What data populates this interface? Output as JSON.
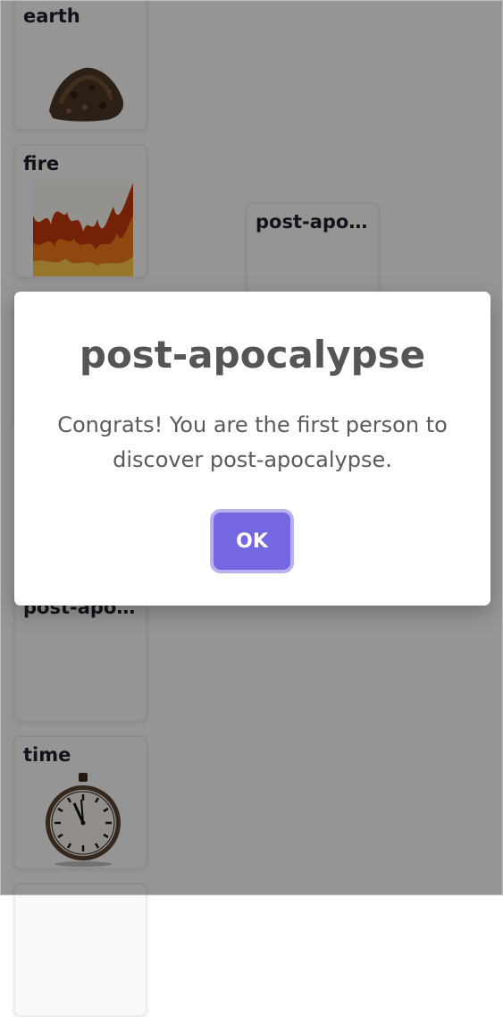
{
  "cards": [
    {
      "name": "earth"
    },
    {
      "name": "fire"
    },
    {
      "name": "post-apocalypse"
    },
    {
      "name": ""
    },
    {
      "name": "post-apocalypse"
    },
    {
      "name": "time"
    },
    {
      "name": ""
    }
  ],
  "dialog": {
    "title": "post-apocalypse",
    "message": "Congrats! You are the first person to discover post-apocalypse.",
    "ok_label": "OK"
  },
  "colors": {
    "accent": "#7566e1",
    "accent_ring": "#b8b1f0",
    "overlay": "rgba(0,0,0,0.40)"
  },
  "icons": {
    "earth": "soil-pile-image",
    "fire": "flames-image",
    "time": "pocket-watch-image"
  }
}
